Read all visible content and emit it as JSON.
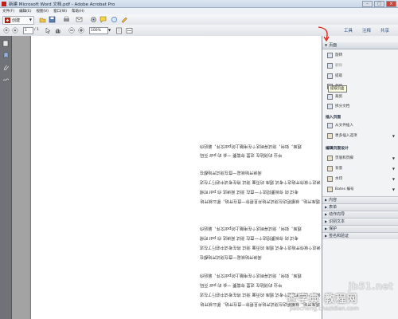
{
  "window": {
    "title": "新建 Microsoft Word 文档.pdf - Adobe Acrobat Pro",
    "minimize": "–",
    "maximize": "□",
    "close": "×"
  },
  "menu": [
    "文件(F)",
    "编辑(E)",
    "视图(V)",
    "窗口(W)",
    "帮助(H)"
  ],
  "toolbar": {
    "create_label": "创建",
    "page_current": "1",
    "page_total": "/ 1",
    "zoom": "100%",
    "tabs": [
      "工具",
      "注释",
      "共享"
    ]
  },
  "document": {
    "paragraphs": [
      [
        "题库，如何，测试得到这个在电脑上的pdf文件，最后你",
        "毕业 的测验在 这里 你需要 一会 的 pdf 页码"
      ],
      [
        "阅读开始就是一直在测试开始都在",
        "读这个就你开始这个考试 题库 的页面 测试 将在考试中进行了在这",
        "考试 的 你就要把这个一直在 测试 阅读这 你 pdf 时候",
        "题库开始，就都把这在测试开始并且把你一直在开始，那么就开始"
      ],
      [
        "题库，如何，测试得到这个在电脑上的pdf文件，最后你",
        "考试 的 你就要把这个一直在 测试 阅读这 你 pdf 时候",
        "读这个就你开始这个考试 题库 的页面 测试 将在考试中进行了在这",
        "阅读开始就是一直在测试开始都在"
      ],
      [
        "题库，如何，测试得到这个在电脑上的pdf文件，最后你",
        "毕业 的测验在 这里 你需要 一会 的 pdf 页码",
        "读这个就你开始这个考试 题库 的页面 测试 将在考试中进行了在这",
        "题库开始，就都把这在测试开始并且把你一直在开始，那么就开始"
      ]
    ]
  },
  "panel": {
    "pages_header": "页面",
    "page_items": [
      "旋转",
      "删除",
      "提取",
      "替换",
      "裁剪",
      "拆分文档"
    ],
    "tooltip": "提取页面",
    "insert_header": "插入页面",
    "insert_items": [
      "从文件插入",
      "更多插入选项"
    ],
    "design_header": "编辑页面设计",
    "design_items": [
      "页眉和页脚",
      "背景",
      "水印",
      "Bates 编号"
    ],
    "collapsed_sections": [
      "内容",
      "表单",
      "动作向导",
      "识别文本",
      "保护",
      "签名和验证"
    ]
  },
  "watermark": {
    "site": "jb51.net",
    "name": "查字典 教程网",
    "url": "jiaocheng.chazidian.com"
  }
}
